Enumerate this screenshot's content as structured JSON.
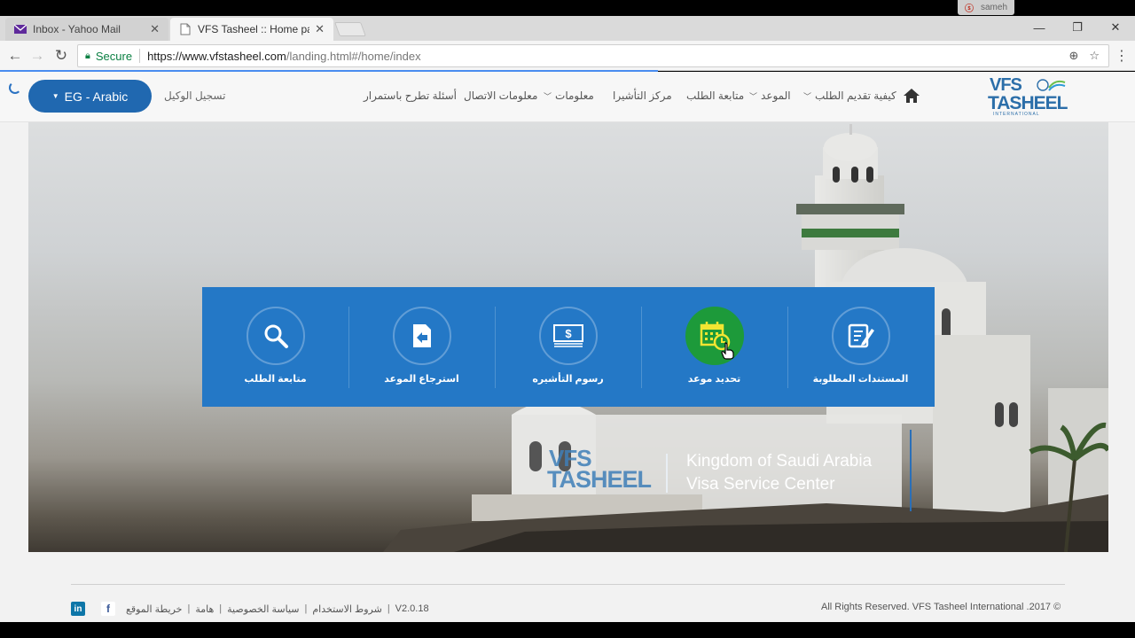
{
  "browser": {
    "tabs": [
      {
        "title": "Inbox - Yahoo Mail",
        "active": false
      },
      {
        "title": "VFS Tasheel :: Home page",
        "active": true
      }
    ],
    "profile_name": "sameh",
    "security_label": "Secure",
    "url_host": "https://www.vfstasheel.com",
    "url_path": "/landing.html#/home/index"
  },
  "header": {
    "language_button": "EG - Arabic",
    "agent_registration": "تسجيل الوكيل",
    "nav": [
      {
        "label": "أسئلة تطرح باستمرار",
        "dropdown": false
      },
      {
        "label": "معلومات الاتصال",
        "dropdown": false
      },
      {
        "label": "معلومات",
        "dropdown": true
      },
      {
        "label": "مركز التأشيرا",
        "dropdown": false
      },
      {
        "label": "متابعة الطلب",
        "dropdown": false
      },
      {
        "label": "الموعد",
        "dropdown": true
      },
      {
        "label": "كيفية تقديم الطلب",
        "dropdown": true
      }
    ],
    "logo": {
      "line1": "VFS",
      "line2": "TASHEEL",
      "line3": "INTERNATIONAL"
    }
  },
  "services": [
    {
      "label": "متابعة الطلب",
      "icon": "search-icon"
    },
    {
      "label": "استرجاع الموعد",
      "icon": "retrieve-appointment-icon"
    },
    {
      "label": "رسوم التأشيره",
      "icon": "visa-fee-icon"
    },
    {
      "label": "تحديد موعد",
      "icon": "calendar-icon"
    },
    {
      "label": "المستندات المطلوبة",
      "icon": "document-edit-icon"
    }
  ],
  "hero": {
    "logo_line1": "VFS",
    "logo_line2": "TASHEEL",
    "title_line1": "Kingdom of Saudi Arabia",
    "title_line2": "Visa Service Center"
  },
  "footer": {
    "version": "V2.0.18",
    "links": [
      "شروط الاستخدام",
      "سياسة الخصوصية",
      "هامة",
      "خريطة الموقع"
    ],
    "copyright": "All Rights Reserved. VFS Tasheel International .2017 ©"
  },
  "colors": {
    "brand_blue": "#2068b0",
    "panel_blue": "#2478c6",
    "highlight_green": "#1d9a3a",
    "linkedin": "#0e76a8",
    "facebook": "#3b5998"
  }
}
